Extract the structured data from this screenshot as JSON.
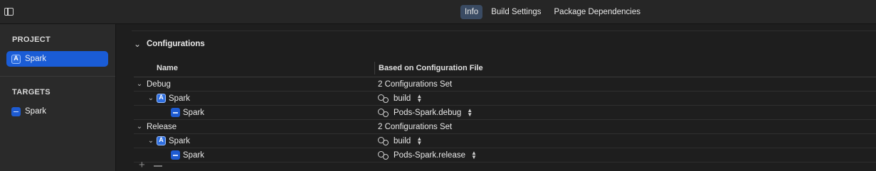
{
  "topbar": {
    "tabs": [
      {
        "label": "Info",
        "active": true
      },
      {
        "label": "Build Settings",
        "active": false
      },
      {
        "label": "Package Dependencies",
        "active": false
      }
    ]
  },
  "sidebar": {
    "project_title": "PROJECT",
    "project_item": "Spark",
    "targets_title": "TARGETS",
    "target_item": "Spark"
  },
  "main": {
    "section_title": "Configurations",
    "columns": {
      "name": "Name",
      "file": "Based on Configuration File"
    },
    "rows": [
      {
        "name": "Debug",
        "file": "2 Configurations Set"
      },
      {
        "name": "Spark",
        "file": "build"
      },
      {
        "name": "Spark",
        "file": "Pods-Spark.debug"
      },
      {
        "name": "Release",
        "file": "2 Configurations Set"
      },
      {
        "name": "Spark",
        "file": "build"
      },
      {
        "name": "Spark",
        "file": "Pods-Spark.release"
      }
    ]
  },
  "colors": {
    "accent": "#1a5cd6",
    "active_tab": "#3a4b63",
    "background": "#1e1e1e"
  }
}
